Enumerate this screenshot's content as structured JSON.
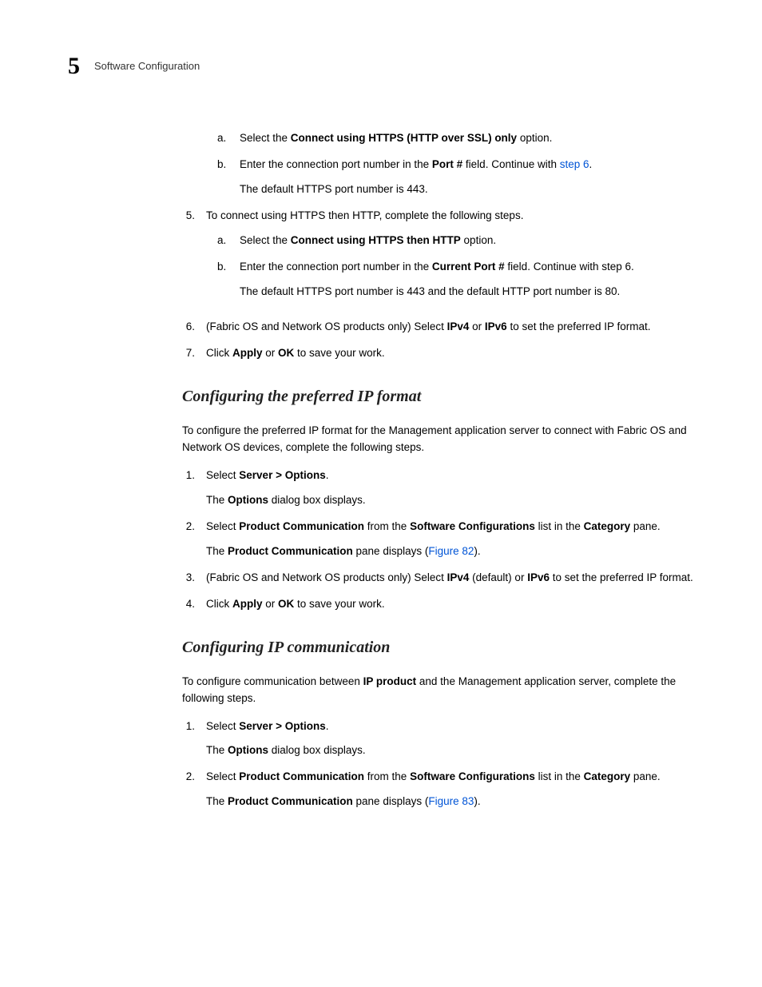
{
  "header": {
    "chapter_num": "5",
    "section_title": "Software Configuration"
  },
  "block1": {
    "sub_a": {
      "pre": "Select the ",
      "bold": "Connect using HTTPS (HTTP over SSL) only",
      "post": " option."
    },
    "sub_b": {
      "pre": "Enter the connection port number in the ",
      "bold": "Port #",
      "mid": " field. Continue with ",
      "link": "step 6",
      "post": ".",
      "extra": "The default HTTPS port number is 443."
    },
    "item5": {
      "text": "To connect using HTTPS then HTTP, complete the following steps.",
      "sub_a": {
        "pre": "Select the ",
        "bold": "Connect using HTTPS then HTTP",
        "post": " option."
      },
      "sub_b": {
        "pre": "Enter the connection port number in the ",
        "bold": "Current Port #",
        "post": " field. Continue with step 6.",
        "extra": "The default HTTPS port number is 443 and the default HTTP port number is 80."
      }
    },
    "item6": {
      "pre": "(Fabric OS and Network OS products only) Select ",
      "b1": "IPv4",
      "mid": " or ",
      "b2": "IPv6",
      "post": " to set the preferred IP format."
    },
    "item7": {
      "pre": "Click ",
      "b1": "Apply",
      "mid": " or ",
      "b2": "OK",
      "post": " to save your work."
    }
  },
  "section2": {
    "heading": "Configuring the preferred IP format",
    "intro": "To configure the preferred IP format for the Management application server to connect with Fabric OS and Network OS devices, complete the following steps.",
    "item1": {
      "pre": "Select ",
      "bold": "Server > Options",
      "post": ".",
      "extra_pre": "The ",
      "extra_bold": "Options",
      "extra_post": " dialog box displays."
    },
    "item2": {
      "pre": "Select ",
      "b1": "Product Communication",
      "mid1": " from the ",
      "b2": "Software Configurations",
      "mid2": " list in the ",
      "b3": "Category",
      "post": " pane.",
      "extra_pre": "The ",
      "extra_bold": "Product Communication",
      "extra_mid": " pane displays (",
      "extra_link": "Figure 82",
      "extra_post": ")."
    },
    "item3": {
      "pre": "(Fabric OS and Network OS products only) Select ",
      "b1": "IPv4",
      "mid1": " (default) or ",
      "b2": "IPv6",
      "post": " to set the preferred IP format."
    },
    "item4": {
      "pre": "Click ",
      "b1": "Apply",
      "mid": " or ",
      "b2": "OK",
      "post": " to save your work."
    }
  },
  "section3": {
    "heading": "Configuring IP communication",
    "intro_pre": "To configure communication between ",
    "intro_bold": "IP product",
    "intro_post": " and the Management application server, complete the following steps.",
    "item1": {
      "pre": "Select ",
      "bold": "Server > Options",
      "post": ".",
      "extra_pre": "The ",
      "extra_bold": "Options",
      "extra_post": " dialog box displays."
    },
    "item2": {
      "pre": "Select ",
      "b1": "Product Communication",
      "mid1": " from the ",
      "b2": "Software Configurations",
      "mid2": " list in the ",
      "b3": "Category",
      "post": " pane.",
      "extra_pre": "The ",
      "extra_bold": "Product Communication",
      "extra_mid": " pane displays (",
      "extra_link": "Figure 83",
      "extra_post": ")."
    }
  }
}
